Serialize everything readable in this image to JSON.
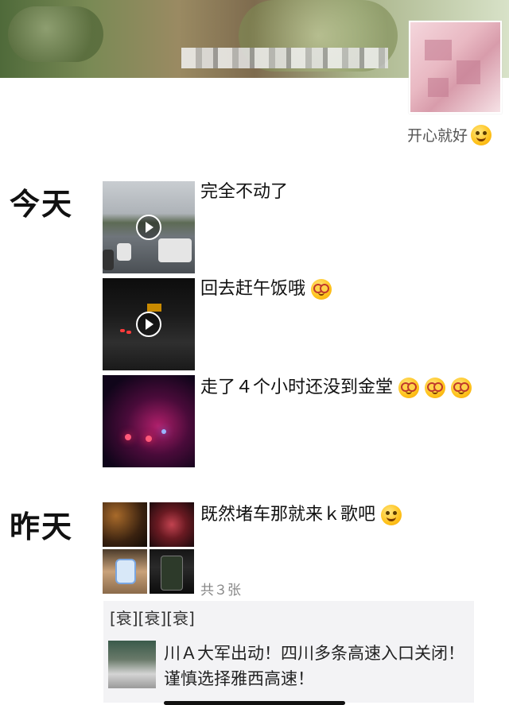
{
  "profile": {
    "signature": "开心就好",
    "signature_emoji": "grin-emoji"
  },
  "sections": [
    {
      "date": "今天",
      "posts": [
        {
          "text": "完全不动了",
          "type": "video"
        },
        {
          "text": "回去赶午饭哦",
          "type": "video",
          "emoji": "dizzy-emoji"
        },
        {
          "text": "走了４个小时还没到金堂",
          "type": "image",
          "emoji": "dizzy-emoji"
        }
      ]
    },
    {
      "date": "昨天",
      "posts": [
        {
          "text": "既然堵车那就来ｋ歌吧",
          "type": "images",
          "count_label": "共３张",
          "emoji": "blush-emoji"
        }
      ]
    }
  ],
  "share": {
    "caption": "[衰][衰][衰]",
    "title": "川Ａ大军出动！四川多条高速入口关闭！谨慎选择雅西高速！"
  },
  "colors": {
    "background": "#ffffff",
    "text": "#111111",
    "muted": "#888888",
    "share_bg": "#f3f3f5"
  }
}
